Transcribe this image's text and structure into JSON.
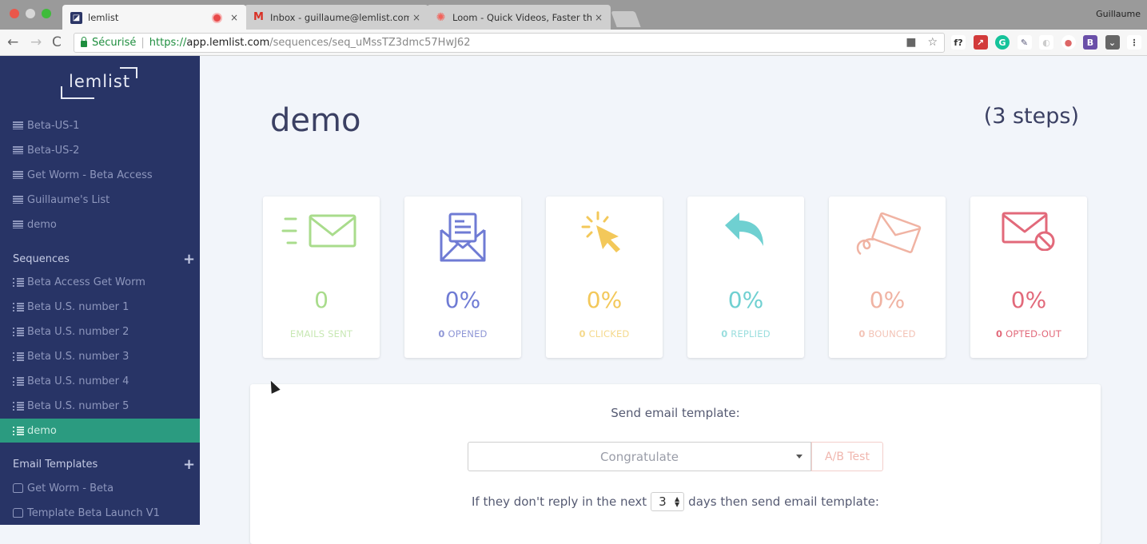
{
  "browser": {
    "tabs": [
      {
        "title": "lemlist",
        "favicon": "lemlist-icon",
        "active": true,
        "recording": true
      },
      {
        "title": "Inbox - guillaume@lemlist.com",
        "favicon": "gmail-icon",
        "active": false
      },
      {
        "title": "Loom - Quick Videos, Faster th",
        "favicon": "loom-icon",
        "active": false
      }
    ],
    "close_glyph": "×",
    "profile_name": "Guillaume",
    "address": {
      "security_label": "Sécurisé",
      "separator": "|",
      "scheme": "https://",
      "host": "app.lemlist.com",
      "path": "/sequences/seq_uMssTZ3dmc57HwJ62"
    },
    "nav": {
      "back": "←",
      "forward": "→",
      "reload": "C"
    },
    "omnibox_icons": {
      "camera": "■",
      "star": "☆"
    },
    "extensions": [
      {
        "name": "fx-extension-icon",
        "glyph": "f?",
        "color": "#ffffff",
        "text": "#333333"
      },
      {
        "name": "red-extension-icon",
        "glyph": "↗",
        "color": "#d23a3a",
        "text": "#ffffff"
      },
      {
        "name": "grammarly-icon",
        "glyph": "G",
        "color": "#15c39a",
        "text": "#ffffff"
      },
      {
        "name": "eyedropper-icon",
        "glyph": "✎",
        "color": "#ffffff",
        "text": "#555577"
      },
      {
        "name": "grey-extension-icon",
        "glyph": "◐",
        "color": "#ffffff",
        "text": "#cccccc"
      },
      {
        "name": "badge-extension-icon",
        "glyph": "●",
        "color": "#ffffff",
        "text": "#d66"
      },
      {
        "name": "b-extension-icon",
        "glyph": "B",
        "color": "#6a4fa8",
        "text": "#ffffff"
      },
      {
        "name": "pocket-icon",
        "glyph": "⌄",
        "color": "#666666",
        "text": "#ffffff"
      },
      {
        "name": "menu-icon",
        "glyph": "⋮",
        "color": "#ffffff",
        "text": "#555555"
      }
    ]
  },
  "sidebar": {
    "logo": "lemlist",
    "lists": [
      {
        "label": "Beta-US-1"
      },
      {
        "label": "Beta-US-2"
      },
      {
        "label": "Get Worm - Beta Access"
      },
      {
        "label": "Guillaume's List"
      },
      {
        "label": "demo"
      }
    ],
    "sequences_header": "Sequences",
    "sequences": [
      {
        "label": "Beta Access Get Worm"
      },
      {
        "label": "Beta U.S. number 1"
      },
      {
        "label": "Beta U.S. number 2"
      },
      {
        "label": "Beta U.S. number 3"
      },
      {
        "label": "Beta U.S. number 4"
      },
      {
        "label": "Beta U.S. number 5"
      },
      {
        "label": "demo",
        "active": true
      }
    ],
    "templates_header": "Email Templates",
    "templates": [
      {
        "label": "Get Worm - Beta"
      },
      {
        "label": "Template Beta Launch V1"
      }
    ],
    "plus": "+"
  },
  "main": {
    "title": "demo",
    "steps": "(3 steps)",
    "stats": [
      {
        "id": "sent",
        "icon": "email-sent-icon",
        "value": "0",
        "count": "",
        "label": "EMAILS SENT",
        "color": "#a9dc8c"
      },
      {
        "id": "opened",
        "icon": "email-opened-icon",
        "value": "0%",
        "count": "0",
        "label": "OPENED",
        "color": "#6f7bd4"
      },
      {
        "id": "clicked",
        "icon": "click-icon",
        "value": "0%",
        "count": "0",
        "label": "CLICKED",
        "color": "#f3c85a"
      },
      {
        "id": "replied",
        "icon": "reply-icon",
        "value": "0%",
        "count": "0",
        "label": "REPLIED",
        "color": "#6fd0d1"
      },
      {
        "id": "bounced",
        "icon": "bounced-icon",
        "value": "0%",
        "count": "0",
        "label": "BOUNCED",
        "color": "#f0b3a3"
      },
      {
        "id": "opted",
        "icon": "opted-out-icon",
        "value": "0%",
        "count": "0",
        "label": "OPTED-OUT",
        "color": "#e2697a"
      }
    ],
    "template_panel": {
      "title": "Send email template:",
      "selected_template": "Congratulate",
      "ab_test_label": "A/B Test",
      "delay_prefix": "If they don't reply in the next",
      "delay_days": "3",
      "delay_suffix": "days then send email template:",
      "spinner": "▲▼"
    }
  }
}
